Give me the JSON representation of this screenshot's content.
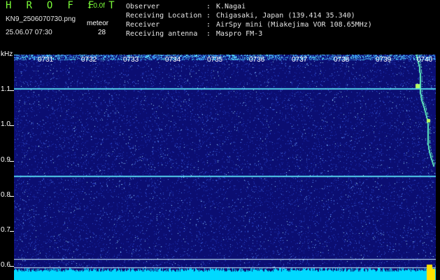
{
  "header": {
    "title": "H R O F F T",
    "version": "1.0.0f",
    "filename": "KN9_2506070730.png",
    "datetime": "25.06.07 07:30",
    "meteor_label": "meteor",
    "meteor_count": "28"
  },
  "info": [
    {
      "label": "Observer",
      "colon": ":",
      "value": "K.Nagai"
    },
    {
      "label": "Receiving Location",
      "colon": ":",
      "value": "Chigasaki, Japan (139.414 35.340)"
    },
    {
      "label": "Receiver",
      "colon": ":",
      "value": "AirSpy mini (Miakejima VOR 108.65MHz)"
    },
    {
      "label": "Receiving antenna",
      "colon": ":",
      "value": "Maspro FM-3"
    }
  ],
  "axis": {
    "unit": "kHz",
    "y_ticks": [
      "1.1",
      "1.0",
      "0.9",
      "0.8",
      "0.7",
      "0.6"
    ],
    "x_ticks": [
      "0731",
      "0732",
      "0733",
      "0734",
      "0735",
      "0736",
      "0737",
      "0738",
      "0739",
      "0740"
    ]
  },
  "colors": {
    "background": "#000000",
    "title": "#7cff3a",
    "spectrogram_base": "#0b0e72",
    "signal_line": "#5ff0ff",
    "level_bar": "#00d9ff"
  }
}
